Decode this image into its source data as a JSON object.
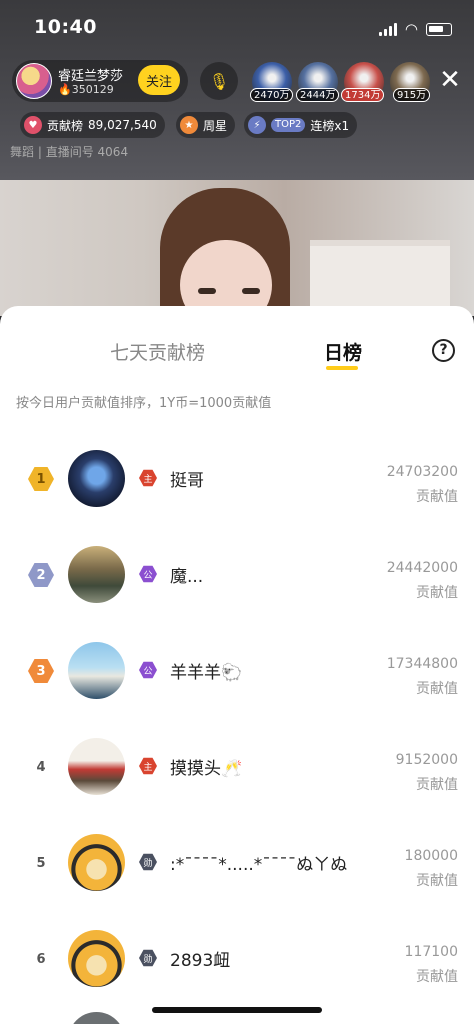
{
  "status": {
    "time": "10:40"
  },
  "host": {
    "name": "睿廷兰梦莎",
    "fans": "350129",
    "follow_label": "关注"
  },
  "viewers": [
    {
      "badge": "2470万",
      "color": "#3c5fa8"
    },
    {
      "badge": "2444万",
      "color": "#5570a0"
    },
    {
      "badge": "1734万",
      "color": "#c8504a"
    },
    {
      "badge": "915万",
      "color": "#7e6a50"
    }
  ],
  "contrib": {
    "label": "贡献榜",
    "value": "89,027,540"
  },
  "week_star": {
    "label": "周星"
  },
  "top2": {
    "tag": "TOP2",
    "label": "连榜x1"
  },
  "room": {
    "category": "舞蹈",
    "sep": "|",
    "room_id": "直播间号 4064"
  },
  "sheet": {
    "tab_seven_days": "七天贡献榜",
    "tab_daily": "日榜",
    "help": "?",
    "rule": "按今日用户贡献值排序，1Y币=1000贡献值"
  },
  "ranking": [
    {
      "rank": "1",
      "badge": "主",
      "badge_color": "#d9442f",
      "name": "挺哥",
      "score": "24703200",
      "score_label": "贡献值"
    },
    {
      "rank": "2",
      "badge": "公",
      "badge_color": "#8b4fd0",
      "name": "魔...",
      "score": "24442000",
      "score_label": "贡献值"
    },
    {
      "rank": "3",
      "badge": "公",
      "badge_color": "#8b4fd0",
      "name": "羊羊羊🐑",
      "score": "17344800",
      "score_label": "贡献值"
    },
    {
      "rank": "4",
      "badge": "主",
      "badge_color": "#d9442f",
      "name": "摸摸头🥂",
      "score": "9152000",
      "score_label": "贡献值"
    },
    {
      "rank": "5",
      "badge": "勋",
      "badge_color": "#4a5060",
      "name": ":*¯¯¯¯*.....*¯¯¯¯ぬㄚぬ",
      "score": "180000",
      "score_label": "贡献值"
    },
    {
      "rank": "6",
      "badge": "勋",
      "badge_color": "#4a5060",
      "name": "2893衄",
      "score": "117100",
      "score_label": "贡献值"
    }
  ],
  "rank_colors": {
    "gold": "#f0b429",
    "silver": "#8f98c8",
    "bronze": "#f08a3a"
  }
}
